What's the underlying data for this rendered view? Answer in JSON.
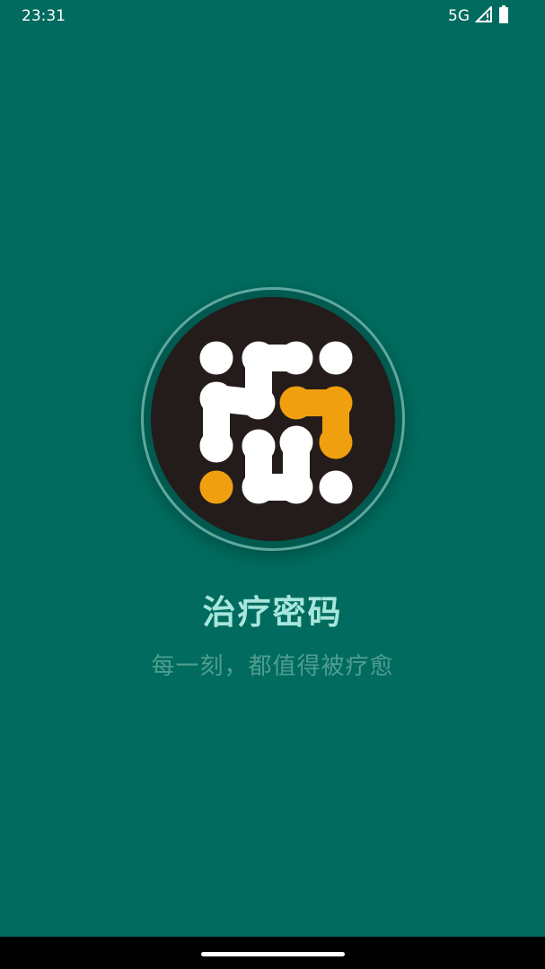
{
  "status_bar": {
    "time": "23:31",
    "network": "5G",
    "signal_icon": "signal-icon",
    "battery_icon": "battery-icon"
  },
  "splash": {
    "logo_icon": "app-logo",
    "title": "治疗密码",
    "slogan": "每一刻，都值得被疗愈"
  },
  "colors": {
    "background": "#006B5E",
    "title": "#a8e6dc",
    "slogan": "#4f9e91",
    "logo_bg": "#241c1a",
    "logo_accent": "#f0a00f",
    "logo_dots": "#ffffff"
  }
}
